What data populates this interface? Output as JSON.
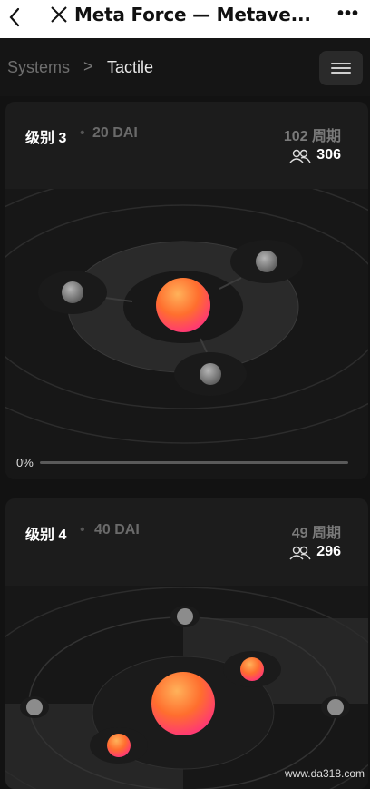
{
  "header": {
    "title": "Meta Force — Metave..."
  },
  "breadcrumb": {
    "root": "Systems",
    "separator": ">",
    "current": "Tactile"
  },
  "cards": [
    {
      "level": "级别 3",
      "separator": "•",
      "dai": "20 DAI",
      "cycles": "102 周期",
      "participants": "306",
      "progress_label": "0%",
      "progress": 0
    },
    {
      "level": "级别 4",
      "separator": "•",
      "dai": "40 DAI",
      "cycles": "49 周期",
      "participants": "296"
    }
  ],
  "watermark": "www.da318.com",
  "colors": {
    "accent_orange": "#ff7a2a",
    "accent_pink": "#ff3f6e",
    "background": "#121212",
    "card": "#1c1c1c"
  }
}
